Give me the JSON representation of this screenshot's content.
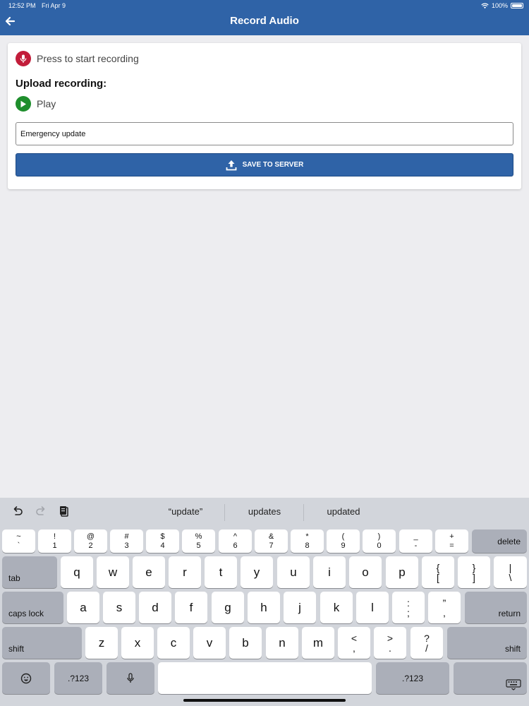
{
  "status": {
    "time": "12:52 PM",
    "date": "Fri Apr 9",
    "battery": "100%"
  },
  "header": {
    "title": "Record Audio",
    "back_icon": "arrow-left-icon"
  },
  "record": {
    "label": "Press to start recording",
    "icon": "mic-icon",
    "color": "#c21d3a"
  },
  "upload": {
    "heading": "Upload recording:",
    "play_label": "Play",
    "play_color": "#1e8e2c"
  },
  "input": {
    "value": "Emergency update"
  },
  "save_button": {
    "label": "SAVE TO SERVER",
    "icon": "upload-icon"
  },
  "colors": {
    "brand": "#2f63a7",
    "background": "#ededf0"
  },
  "keyboard": {
    "suggestions": [
      "“update”",
      "updates",
      "updated"
    ],
    "number_row": [
      {
        "top": "~",
        "bottom": "`"
      },
      {
        "top": "!",
        "bottom": "1"
      },
      {
        "top": "@",
        "bottom": "2"
      },
      {
        "top": "#",
        "bottom": "3"
      },
      {
        "top": "$",
        "bottom": "4"
      },
      {
        "top": "%",
        "bottom": "5"
      },
      {
        "top": "^",
        "bottom": "6"
      },
      {
        "top": "&",
        "bottom": "7"
      },
      {
        "top": "*",
        "bottom": "8"
      },
      {
        "top": "(",
        "bottom": "9"
      },
      {
        "top": ")",
        "bottom": "0"
      },
      {
        "top": "_",
        "bottom": "-"
      },
      {
        "top": "+",
        "bottom": "="
      }
    ],
    "delete": "delete",
    "tab": "tab",
    "row_q": [
      "q",
      "w",
      "e",
      "r",
      "t",
      "y",
      "u",
      "i",
      "o",
      "p"
    ],
    "bracket_keys": [
      {
        "top": "{",
        "bottom": "["
      },
      {
        "top": "}",
        "bottom": "]"
      },
      {
        "top": "|",
        "bottom": "\\"
      }
    ],
    "caps_lock": "caps lock",
    "row_a": [
      "a",
      "s",
      "d",
      "f",
      "g",
      "h",
      "j",
      "k",
      "l"
    ],
    "punct_keys": [
      {
        "top": ":",
        "bottom": ";"
      },
      {
        "top": "”",
        "bottom": ","
      }
    ],
    "return": "return",
    "shift": "shift",
    "row_z": [
      "z",
      "x",
      "c",
      "v",
      "b",
      "n",
      "m"
    ],
    "angle_keys": [
      {
        "top": "<",
        "bottom": ","
      },
      {
        "top": ">",
        "bottom": "."
      },
      {
        "top": "?",
        "bottom": "/"
      }
    ],
    "numbers_label": ".?123"
  }
}
